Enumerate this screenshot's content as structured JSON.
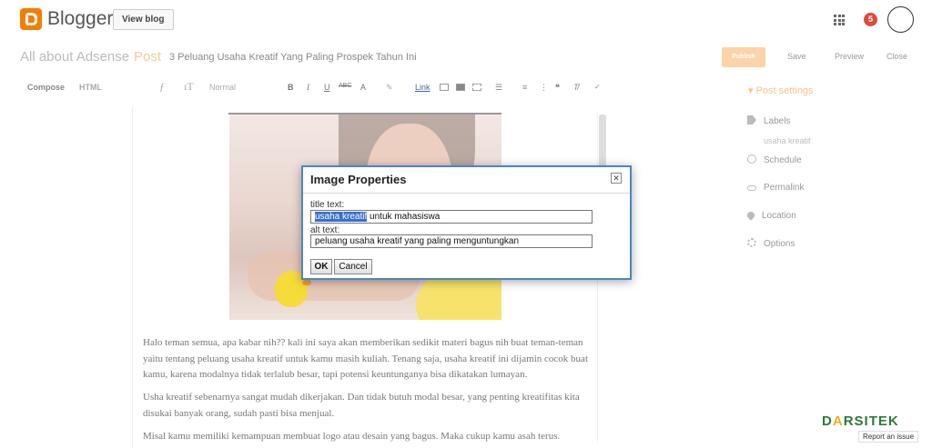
{
  "app": {
    "name": "Blogger",
    "view_blog": "View blog",
    "notifications": "5"
  },
  "header": {
    "blog_name": "All about Adsense",
    "section": "Post",
    "post_title": "3 Peluang Usaha Kreatif Yang Paling Prospek Tahun Ini",
    "publish": "Publish",
    "save": "Save",
    "preview": "Preview",
    "close": "Close"
  },
  "toolbar": {
    "compose": "Compose",
    "html": "HTML",
    "font_icon": "ƒ",
    "size_icon": "ıT",
    "format": "Normal",
    "bold": "B",
    "italic": "I",
    "underline": "U",
    "strike": "ABC",
    "text_color": "A",
    "link": "Link"
  },
  "editor": {
    "paragraph1": "Halo teman semua, apa kabar nih?? kali ini saya akan memberikan sedikit materi bagus nih buat teman-teman yaitu tentang peluang usaha kreatif untuk kamu masih kuliah. Tenang saja, usaha kreatif ini dijamin cocok buat kamu, karena modalnya tidak terlalub besar, tapi potensi keuntunganya bisa dikatakan lumayan.",
    "paragraph2": "Usha kreatif sebenarnya sangat mudah dikerjakan. Dan tidak butuh modal besar, yang penting kreatifitas kita disukai banyak orang, sudah pasti bisa menjual.",
    "paragraph3": "Misal kamu memiliki kemampuan membuat logo atau desain yang bagus. Maka cukup kamu asah terus."
  },
  "dialog": {
    "title": "Image Properties",
    "close": "✕",
    "title_label": "title text:",
    "title_value_selected": "usaha kreatif",
    "title_value_rest": " untuk mahasiswa",
    "alt_label": "alt text:",
    "alt_value": "peluang usaha kreatif yang paling menguntungkan",
    "ok": "OK",
    "cancel": "Cancel"
  },
  "sidebar": {
    "heading": "▾ Post settings",
    "labels": "Labels",
    "labels_value": "usaha kreatif",
    "schedule": "Schedule",
    "permalink": "Permalink",
    "location": "Location",
    "options": "Options"
  },
  "watermark": {
    "brand_left": "D",
    "brand_o": "A",
    "brand_right": "RSITEK",
    "report": "Report an issue"
  }
}
